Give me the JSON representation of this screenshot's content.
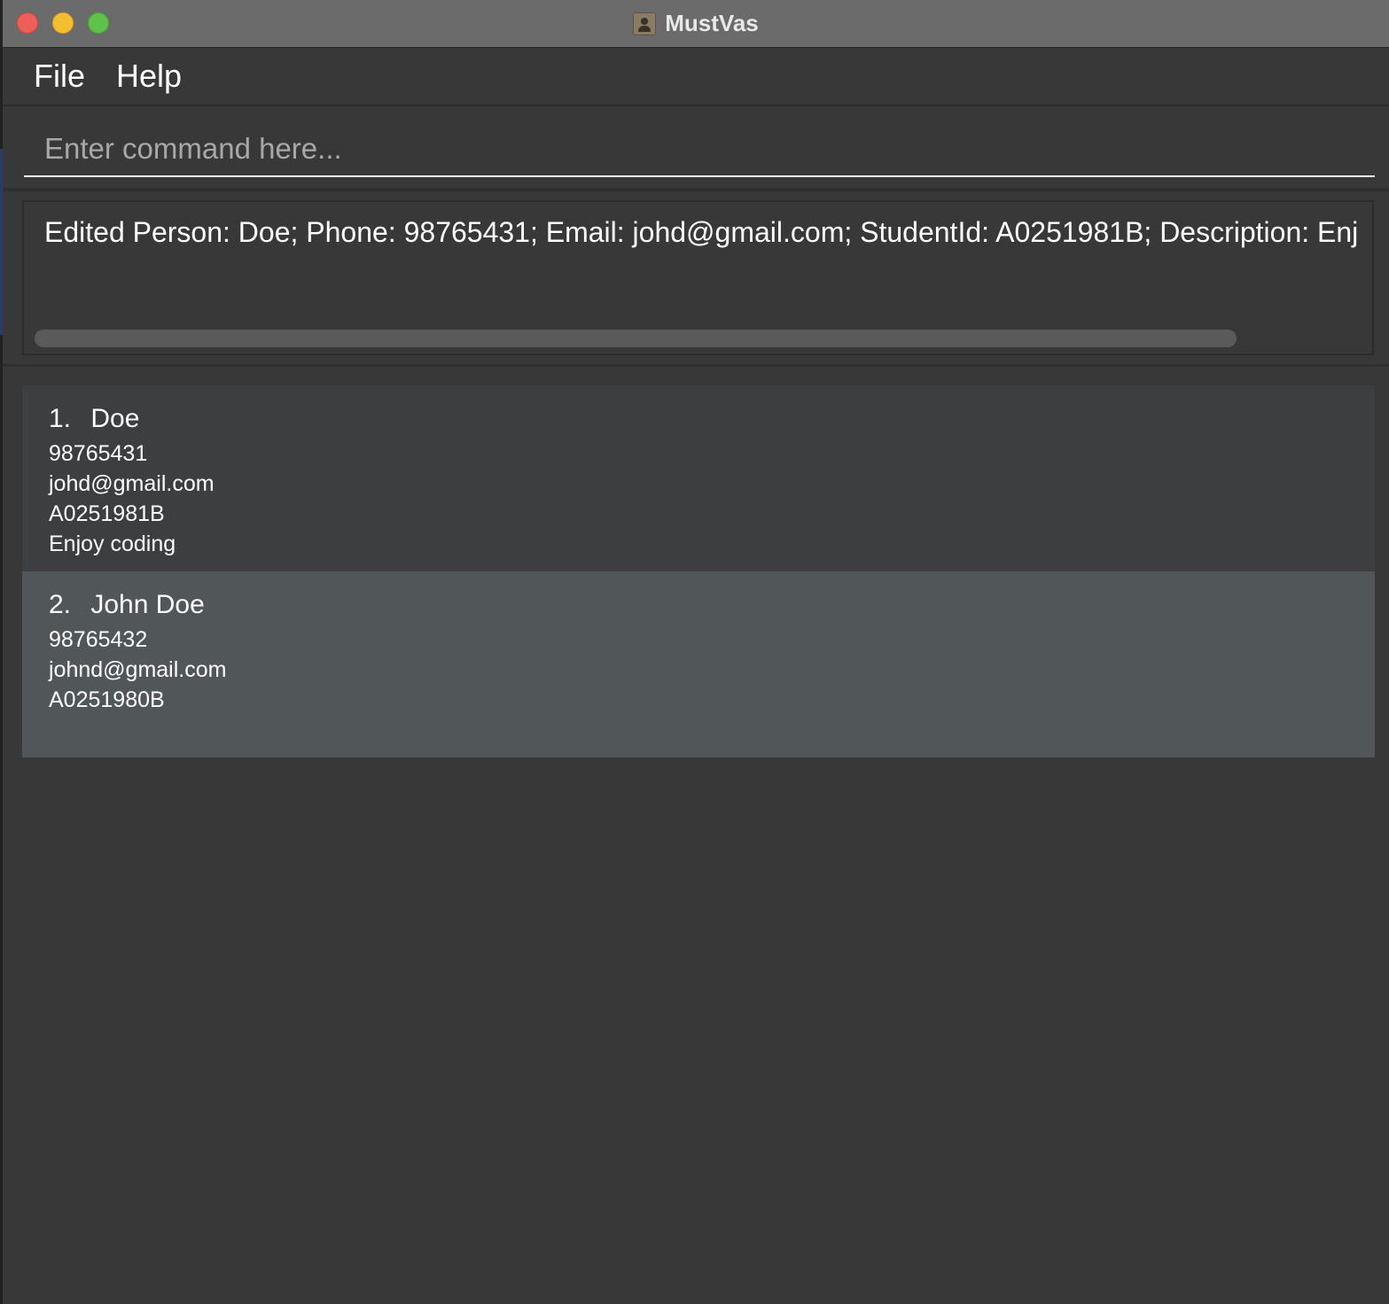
{
  "window": {
    "title": "MustVas",
    "app_icon": "contacts-icon"
  },
  "menu": {
    "file": "File",
    "help": "Help"
  },
  "command": {
    "placeholder": "Enter command here...",
    "value": ""
  },
  "result": {
    "text": "Edited Person: Doe; Phone: 98765431; Email: johd@gmail.com; StudentId: A0251981B; Description: Enj"
  },
  "persons": [
    {
      "index": "1.",
      "name": "Doe",
      "phone": "98765431",
      "email": "johd@gmail.com",
      "student_id": "A0251981B",
      "description": "Enjoy coding"
    },
    {
      "index": "2.",
      "name": "John Doe",
      "phone": "98765432",
      "email": "johnd@gmail.com",
      "student_id": "A0251980B",
      "description": ""
    }
  ],
  "colors": {
    "window_bg": "#383838",
    "titlebar_bg": "#6b6b6b",
    "card_odd_bg": "#3c3e3f",
    "card_selected_bg": "#515658",
    "close": "#ee5f58",
    "minimize": "#f5be2f",
    "maximize": "#5fc24a"
  }
}
